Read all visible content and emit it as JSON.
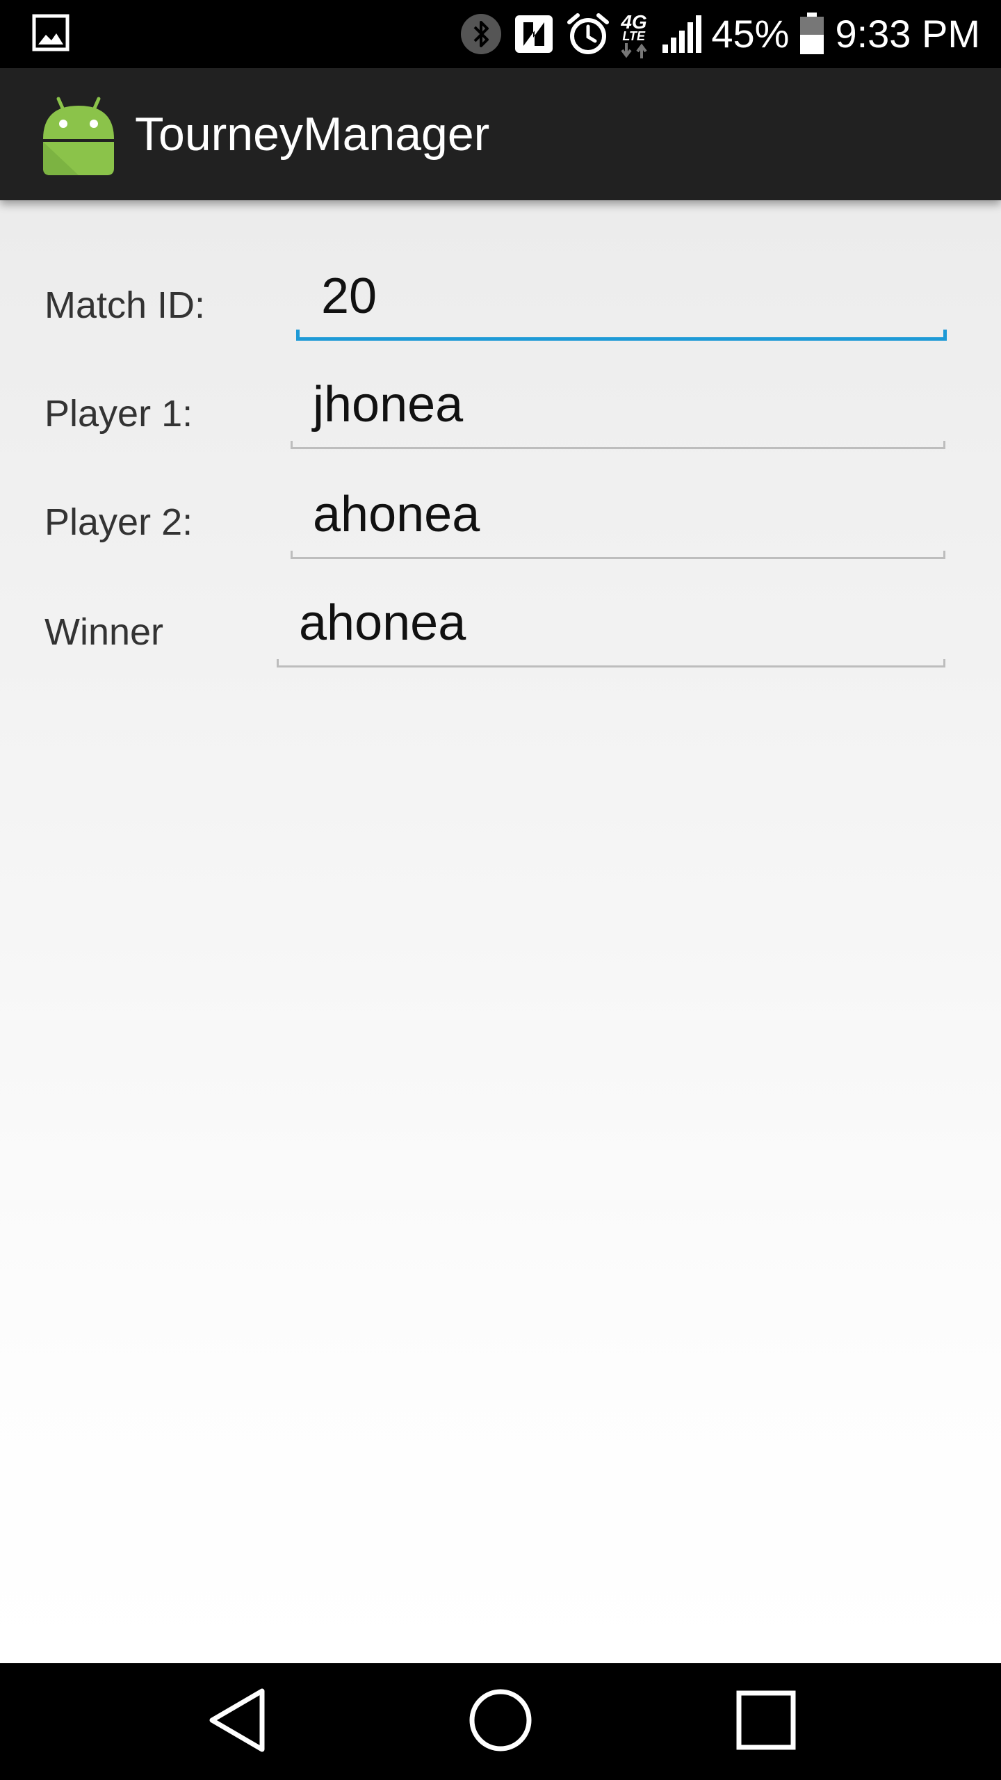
{
  "status_bar": {
    "left_icon": "image-icon",
    "icons": [
      "bluetooth-icon",
      "nfc-icon",
      "alarm-icon",
      "4g-lte-icon",
      "signal-icon"
    ],
    "network_label": "4G",
    "network_sublabel": "LTE",
    "battery_percent": "45%",
    "battery_icon": "battery-icon",
    "time": "9:33 PM"
  },
  "action_bar": {
    "app_icon": "android-icon",
    "title": "TourneyManager"
  },
  "form": {
    "match_id": {
      "label": "Match ID:",
      "value": "20"
    },
    "player1": {
      "label": "Player 1:",
      "value": "jhonea"
    },
    "player2": {
      "label": "Player 2:",
      "value": "ahonea"
    },
    "winner": {
      "label": "Winner",
      "value": "ahonea"
    }
  },
  "nav_bar": {
    "back_icon": "back-icon",
    "home_icon": "home-icon",
    "recents_icon": "recents-icon"
  },
  "colors": {
    "status_bar": "#000000",
    "action_bar": "#212121",
    "focus_accent": "#1e9ad6",
    "android_green": "#8bc34a"
  }
}
